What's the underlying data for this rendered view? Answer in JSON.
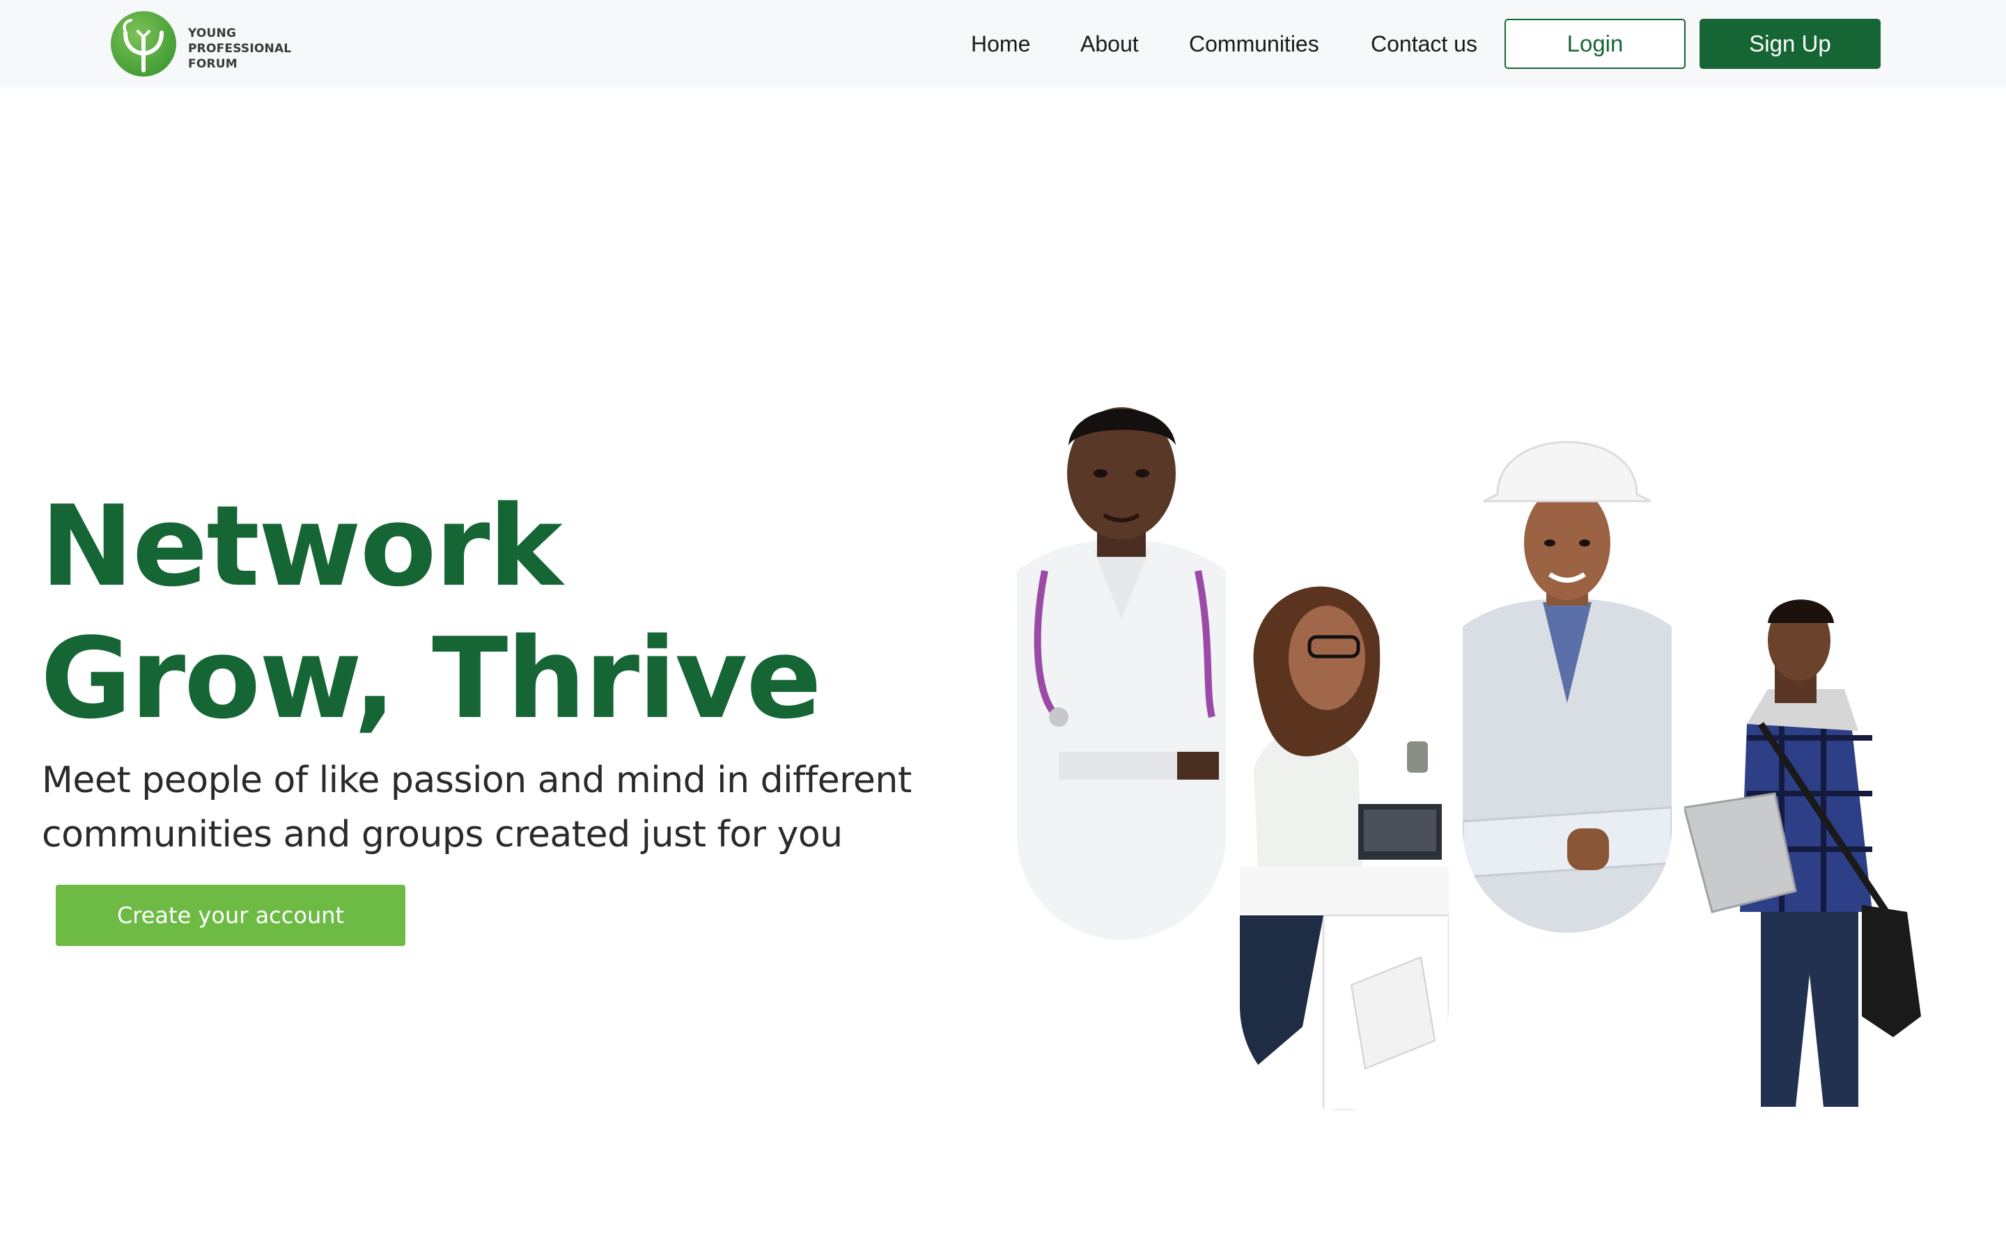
{
  "brand": {
    "name_lines": [
      "YOUNG",
      "PROFESSIONAL",
      "FORUM"
    ],
    "logo_icon": "tree-leaf-logo",
    "primary_color": "#166534",
    "accent_color": "#6dbb45"
  },
  "nav": {
    "links": [
      "Home",
      "About",
      "Communities",
      "Contact us"
    ],
    "login_label": "Login",
    "signup_label": "Sign Up"
  },
  "hero": {
    "title_lines": [
      "Network",
      "Grow, Thrive"
    ],
    "subtitle_lines": [
      "Meet people of like passion and mind in different",
      "communities and groups created just for you"
    ],
    "cta_label": "Create your account"
  },
  "collage": {
    "people": [
      "doctor",
      "woman-at-desk",
      "engineer",
      "student-with-laptop"
    ]
  }
}
